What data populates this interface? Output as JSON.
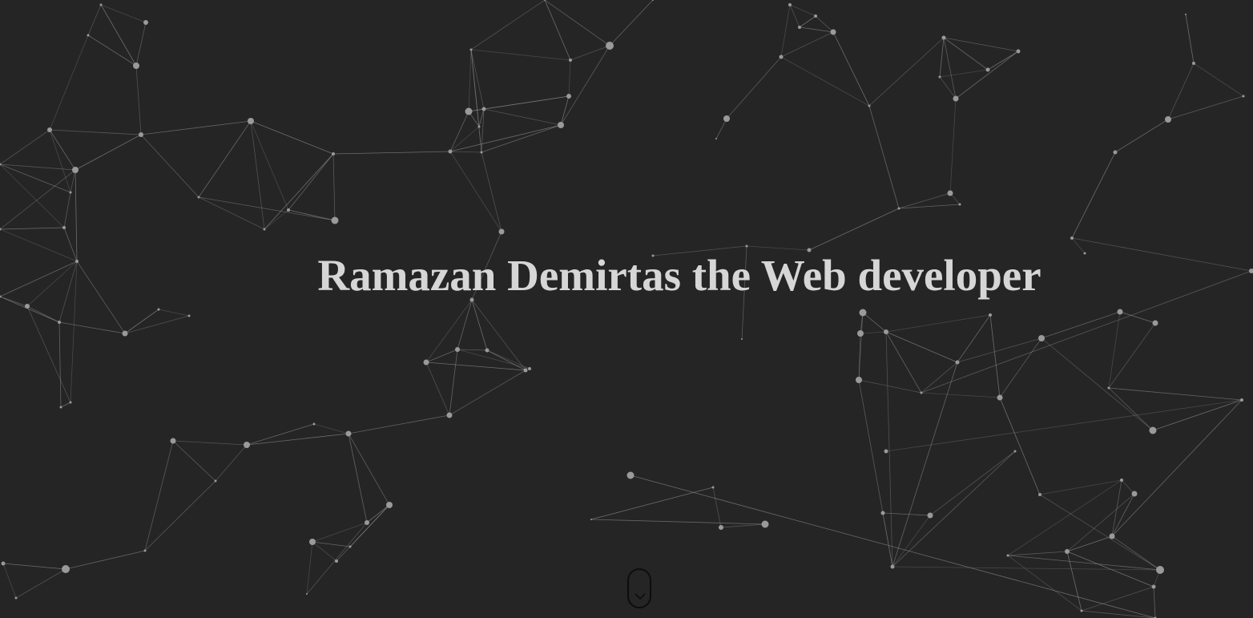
{
  "hero": {
    "title": "Ramazan Demirtas the Web developer"
  },
  "scroll_indicator": {
    "icon": "chevron-down-icon"
  },
  "theme": {
    "background": "#252525",
    "text": "#d6d6d6",
    "network_node": "#9a9a9a",
    "network_line": "#8a8a8a"
  }
}
